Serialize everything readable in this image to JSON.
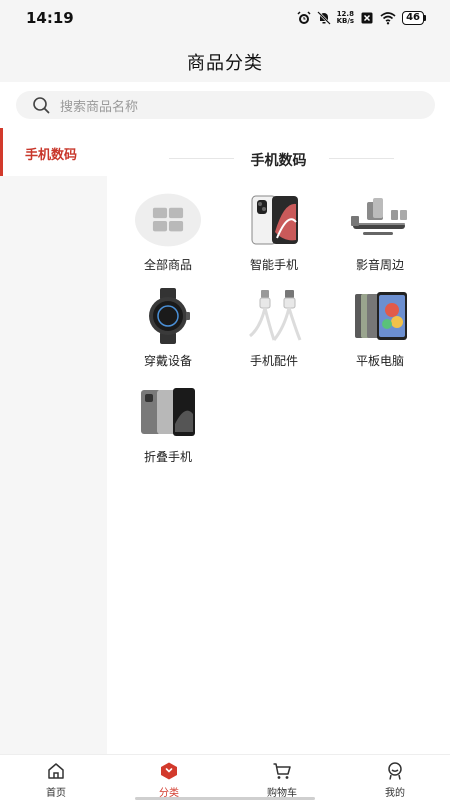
{
  "status_bar": {
    "time": "14:19",
    "net_speed_value": "12.8",
    "net_speed_unit": "KB/s",
    "battery": "46"
  },
  "header": {
    "title": "商品分类"
  },
  "search": {
    "placeholder": "搜索商品名称"
  },
  "sidebar": {
    "items": [
      {
        "label": "手机数码",
        "active": true
      }
    ]
  },
  "main": {
    "section_title": "手机数码",
    "items": [
      {
        "label": "全部商品",
        "icon": "grid-icon"
      },
      {
        "label": "智能手机",
        "icon": "smartphone-image"
      },
      {
        "label": "影音周边",
        "icon": "audio-image"
      },
      {
        "label": "穿戴设备",
        "icon": "smartwatch-image"
      },
      {
        "label": "手机配件",
        "icon": "cable-image"
      },
      {
        "label": "平板电脑",
        "icon": "tablet-image"
      },
      {
        "label": "折叠手机",
        "icon": "foldable-phone-image"
      }
    ]
  },
  "tabbar": {
    "tabs": [
      {
        "label": "首页",
        "icon": "home-icon"
      },
      {
        "label": "分类",
        "icon": "category-icon",
        "active": true
      },
      {
        "label": "购物车",
        "icon": "cart-icon"
      },
      {
        "label": "我的",
        "icon": "profile-icon"
      }
    ]
  },
  "colors": {
    "accent": "#d23a2c",
    "background": "#f5f5f5"
  }
}
